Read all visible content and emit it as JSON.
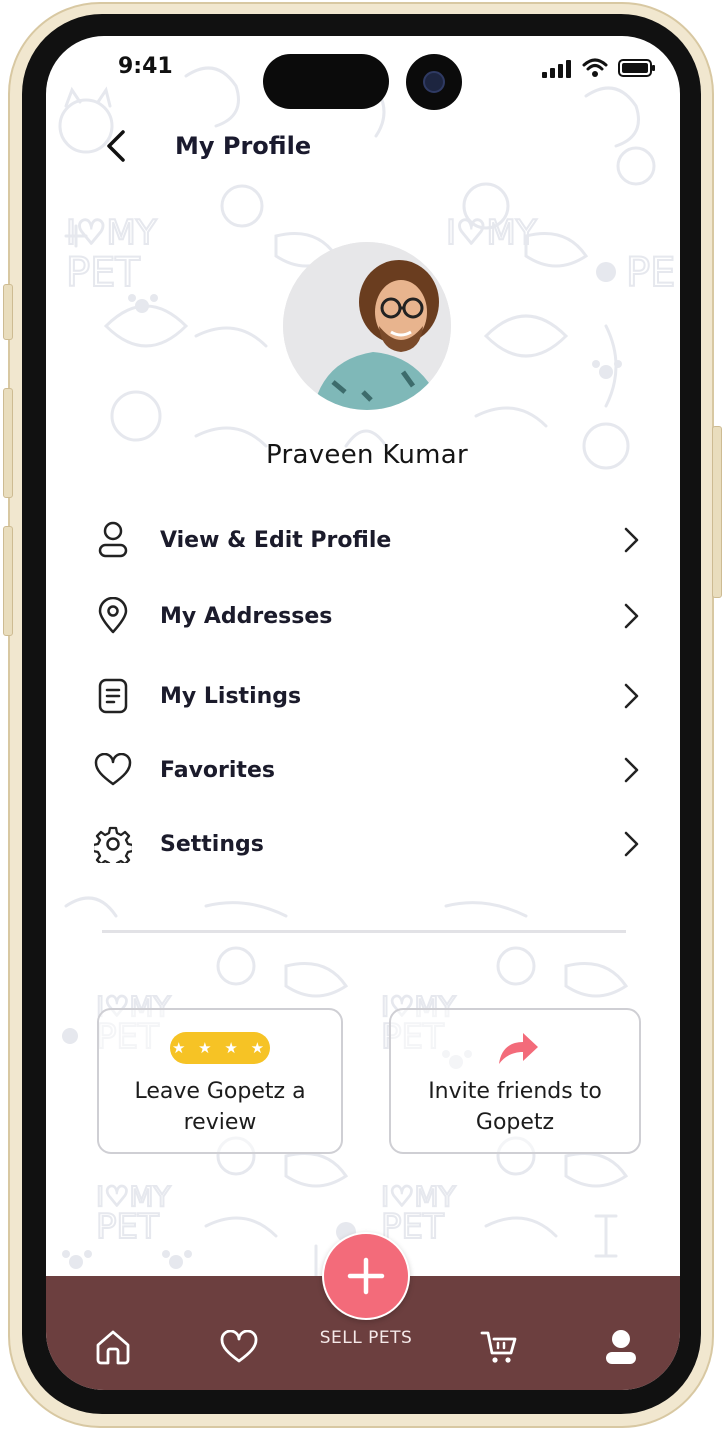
{
  "status_bar": {
    "time": "9:41",
    "icons": [
      "signal-icon",
      "wifi-icon",
      "battery-icon"
    ]
  },
  "header": {
    "title": "My Profile",
    "back_icon": "chevron-left-icon"
  },
  "profile": {
    "name": "Praveen Kumar"
  },
  "menu": {
    "items": [
      {
        "label": "View & Edit Profile",
        "icon": "user-icon"
      },
      {
        "label": "My Addresses",
        "icon": "location-pin-icon"
      },
      {
        "label": "My Listings",
        "icon": "document-icon"
      },
      {
        "label": "Favorites",
        "icon": "heart-icon"
      },
      {
        "label": "Settings",
        "icon": "gear-icon"
      }
    ]
  },
  "cards": {
    "review": {
      "stars": "★ ★ ★ ★",
      "text": "Leave Gopetz a review",
      "icon": "star-rating-icon"
    },
    "invite": {
      "text": "Invite friends to Gopetz",
      "icon": "share-arrow-icon"
    }
  },
  "tabbar": {
    "sell_label": "SELL PETS",
    "items": [
      "home-icon",
      "heart-icon",
      "plus-icon",
      "cart-icon",
      "profile-icon"
    ]
  },
  "colors": {
    "tabbar": "#6c3f3f",
    "fab": "#f36b7a",
    "stars_badge": "#f6c325",
    "text": "#1b1b2b"
  }
}
